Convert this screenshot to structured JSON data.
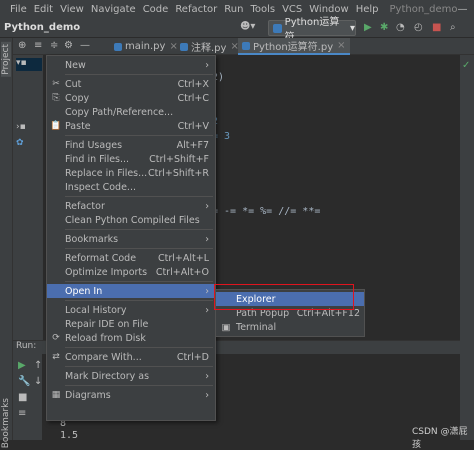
{
  "menubar": {
    "items": [
      "File",
      "Edit",
      "View",
      "Navigate",
      "Code",
      "Refactor",
      "Run",
      "Tools",
      "VCS",
      "Window",
      "Help"
    ],
    "project": "Python_demo",
    "minimize": "—"
  },
  "toolbar": {
    "title": "Python_demo",
    "run_config": "Python运算符"
  },
  "tabs": [
    {
      "label": "main.py"
    },
    {
      "label": "注释.py"
    },
    {
      "label": "Python运算符.py"
    }
  ],
  "side": {
    "project_label": "Project",
    "bookmarks_label": "Bookmarks"
  },
  "code": {
    "line1": "2)",
    "line2": "2",
    "line3": "= 3",
    "line4": "=  -=   *=  %=  //=   **="
  },
  "run": {
    "label": "Run:",
    "out1": "8",
    "out2": "1.5"
  },
  "context_menu": [
    {
      "label": "New",
      "shortcut": "",
      "arrow": "›",
      "icon": ""
    },
    {
      "sep": true
    },
    {
      "label": "Cut",
      "shortcut": "Ctrl+X",
      "icon": "✂"
    },
    {
      "label": "Copy",
      "shortcut": "Ctrl+C",
      "icon": "⎘"
    },
    {
      "label": "Copy Path/Reference...",
      "shortcut": "",
      "icon": ""
    },
    {
      "label": "Paste",
      "shortcut": "Ctrl+V",
      "icon": "📋"
    },
    {
      "sep": true
    },
    {
      "label": "Find Usages",
      "shortcut": "Alt+F7",
      "icon": ""
    },
    {
      "label": "Find in Files...",
      "shortcut": "Ctrl+Shift+F",
      "icon": ""
    },
    {
      "label": "Replace in Files...",
      "shortcut": "Ctrl+Shift+R",
      "icon": ""
    },
    {
      "label": "Inspect Code...",
      "shortcut": "",
      "icon": ""
    },
    {
      "sep": true
    },
    {
      "label": "Refactor",
      "shortcut": "",
      "arrow": "›",
      "icon": ""
    },
    {
      "label": "Clean Python Compiled Files",
      "shortcut": "",
      "icon": ""
    },
    {
      "sep": true
    },
    {
      "label": "Bookmarks",
      "shortcut": "",
      "arrow": "›",
      "icon": ""
    },
    {
      "sep": true
    },
    {
      "label": "Reformat Code",
      "shortcut": "Ctrl+Alt+L",
      "icon": ""
    },
    {
      "label": "Optimize Imports",
      "shortcut": "Ctrl+Alt+O",
      "icon": ""
    },
    {
      "sep": true
    },
    {
      "label": "Open In",
      "shortcut": "",
      "arrow": "›",
      "icon": "",
      "highlight": true
    },
    {
      "sep": true
    },
    {
      "label": "Local History",
      "shortcut": "",
      "arrow": "›",
      "icon": ""
    },
    {
      "label": "Repair IDE on File",
      "shortcut": "",
      "icon": ""
    },
    {
      "label": "Reload from Disk",
      "shortcut": "",
      "icon": "⟳"
    },
    {
      "sep": true
    },
    {
      "label": "Compare With...",
      "shortcut": "Ctrl+D",
      "icon": "⇄"
    },
    {
      "sep": true
    },
    {
      "label": "Mark Directory as",
      "shortcut": "",
      "arrow": "›",
      "icon": ""
    },
    {
      "sep": true
    },
    {
      "label": "Diagrams",
      "shortcut": "",
      "arrow": "›",
      "icon": "▦"
    }
  ],
  "submenu": [
    {
      "label": "Explorer",
      "shortcut": "",
      "highlight": true
    },
    {
      "label": "Path Popup",
      "shortcut": "Ctrl+Alt+F12"
    },
    {
      "label": "Terminal",
      "shortcut": "",
      "icon": "▣"
    }
  ],
  "watermark": "CSDN @潇屁孩",
  "colors": {
    "accent": "#4b6eaf",
    "annotation": "#e0141e"
  }
}
